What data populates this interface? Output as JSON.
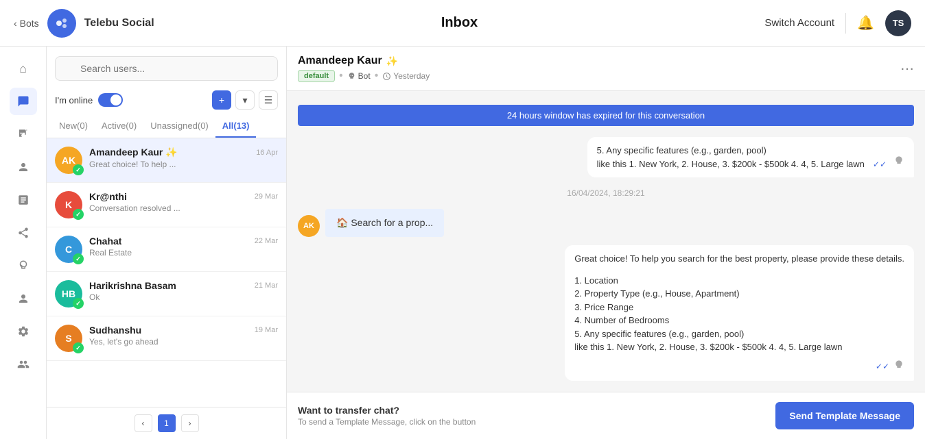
{
  "topnav": {
    "back_label": "Bots",
    "brand": "Telebu Social",
    "title": "Inbox",
    "switch_account": "Switch Account",
    "avatar_initials": "TS"
  },
  "sidebar": {
    "icons": [
      {
        "name": "home-icon",
        "symbol": "⌂"
      },
      {
        "name": "chat-icon",
        "symbol": "💬"
      },
      {
        "name": "megaphone-icon",
        "symbol": "📣"
      },
      {
        "name": "users-icon",
        "symbol": "👥"
      },
      {
        "name": "chart-icon",
        "symbol": "📊"
      },
      {
        "name": "share-icon",
        "symbol": "🔗"
      },
      {
        "name": "bulb-icon",
        "symbol": "💡"
      },
      {
        "name": "person-icon",
        "symbol": "👤"
      },
      {
        "name": "settings-icon",
        "symbol": "⚙"
      },
      {
        "name": "team-icon",
        "symbol": "👥"
      }
    ]
  },
  "conv_list": {
    "search_placeholder": "Search users...",
    "online_label": "I'm online",
    "tabs": [
      {
        "label": "New(0)",
        "key": "new"
      },
      {
        "label": "Active(0)",
        "key": "active"
      },
      {
        "label": "Unassigned(0)",
        "key": "unassigned"
      },
      {
        "label": "All(13)",
        "key": "all",
        "active": true
      }
    ],
    "conversations": [
      {
        "initials": "AK",
        "bg": "#f5a623",
        "name": "Amandeep Kaur ✨",
        "date": "16 Apr",
        "preview": "Great choice! To help ...",
        "active": true
      },
      {
        "initials": "K",
        "bg": "#e74c3c",
        "name": "Kr@nthi",
        "date": "29 Mar",
        "preview": "Conversation resolved ...",
        "active": false
      },
      {
        "initials": "C",
        "bg": "#3498db",
        "name": "Chahat",
        "date": "22 Mar",
        "preview": "Real Estate",
        "active": false
      },
      {
        "initials": "HB",
        "bg": "#1abc9c",
        "name": "Harikrishna Basam",
        "date": "21 Mar",
        "preview": "Ok",
        "active": false
      },
      {
        "initials": "S",
        "bg": "#e67e22",
        "name": "Sudhanshu",
        "date": "19 Mar",
        "preview": "Yes, let's go ahead",
        "active": false
      }
    ],
    "page_current": "1"
  },
  "chat": {
    "user_name": "Amandeep Kaur",
    "star": "✨",
    "tag_default": "default",
    "tag_bot": "Bot",
    "tag_time": "Yesterday",
    "banner": "24 hours window has expired for this conversation",
    "messages": [
      {
        "side": "right",
        "text": "5. Any specific features (e.g., garden, pool)\nlike this 1. New York, 2. House, 3. $200k - $500k 4. 4, 5. Large lawn",
        "has_check": true,
        "has_bot": true
      },
      {
        "side": "center",
        "text": "16/04/2024, 18:29:21"
      },
      {
        "side": "left",
        "text": "🏠 Search for a prop...",
        "avatar": "AK"
      },
      {
        "side": "right",
        "text": "Great choice! To help you search for the best property, please provide these details.\n\n1. Location\n2. Property Type (e.g., House, Apartment)\n3. Price Range\n4. Number of Bedrooms\n5. Any specific features (e.g., garden, pool)\nlike this 1. New York, 2. House, 3. $200k - $500k 4. 4, 5. Large lawn",
        "has_check": true,
        "has_bot": true
      }
    ],
    "bottom_main": "Want to transfer chat?",
    "bottom_sub": "To send a Template Message, click on the button",
    "send_btn": "Send Template Message"
  }
}
